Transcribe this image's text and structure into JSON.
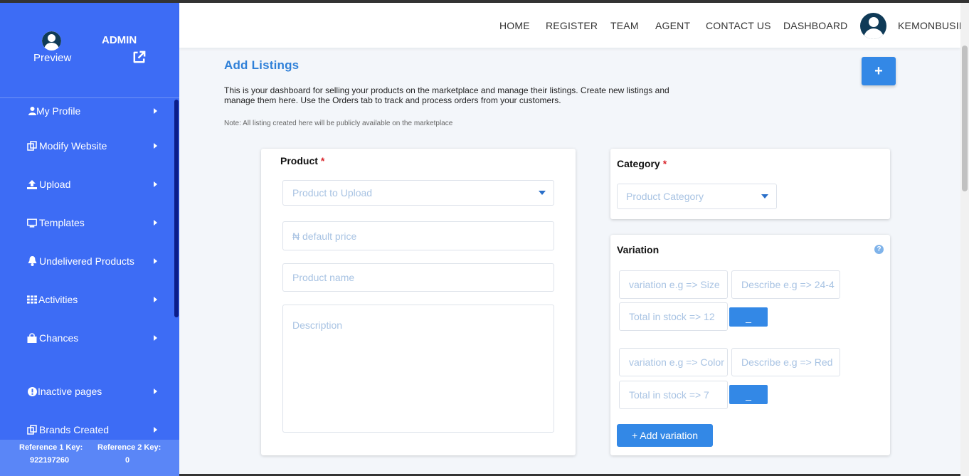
{
  "sidebar": {
    "admin_label": "ADMIN",
    "preview_label": "Preview",
    "items": [
      {
        "label": "My Profile",
        "icon": "user-icon"
      },
      {
        "label": "Modify Website",
        "icon": "copy-icon"
      },
      {
        "label": "Upload",
        "icon": "upload-icon"
      },
      {
        "label": "Templates",
        "icon": "desktop-icon"
      },
      {
        "label": "Undelivered Products",
        "icon": "bell-icon"
      },
      {
        "label": "Activities",
        "icon": "grid-icon"
      },
      {
        "label": "Chances",
        "icon": "bag-icon"
      },
      {
        "label": "Inactive pages",
        "icon": "exclamation-icon"
      },
      {
        "label": "Brands Created",
        "icon": "copy-icon"
      }
    ],
    "footer": {
      "ref1_key": "Reference 1 Key:",
      "ref1_value": "922197260",
      "ref2_key": "Reference 2 Key:",
      "ref2_value": "0"
    }
  },
  "nav": {
    "links": [
      "HOME",
      "REGISTER",
      "TEAM",
      "AGENT",
      "CONTACT US",
      "DASHBOARD"
    ],
    "username": "KEMONBUSIN"
  },
  "main": {
    "title": "Add Listings",
    "intro": "This is your dashboard for selling your products on the marketplace and manage their listings. Create new listings and manage them here. Use the Orders tab to track and process orders from your customers.",
    "note": "Note: All listing created here will be publicly available on the marketplace",
    "add_button": "+"
  },
  "product_card": {
    "label": "Product",
    "required": "*",
    "product_select_placeholder": "Product to Upload",
    "price_placeholder": "₦ default price",
    "name_placeholder": "Product name",
    "description_placeholder": "Description"
  },
  "category_card": {
    "label": "Category",
    "required": "*",
    "select_placeholder": "Product Category"
  },
  "variation_card": {
    "label": "Variation",
    "help": "?",
    "rows": [
      {
        "variation_placeholder": "variation e.g => Size",
        "describe_placeholder": "Describe e.g => 24-4",
        "stock_placeholder": "Total in stock => 12",
        "remove_label": "_"
      },
      {
        "variation_placeholder": "variation e.g => Color",
        "describe_placeholder": "Describe e.g => Red",
        "stock_placeholder": "Total in stock => 7",
        "remove_label": "_"
      }
    ],
    "add_variation_label": "+ Add variation"
  },
  "colors": {
    "sidebar": "#3d6cf5",
    "accent": "#3388e6",
    "title": "#2f80d8",
    "required": "#d9262c"
  }
}
